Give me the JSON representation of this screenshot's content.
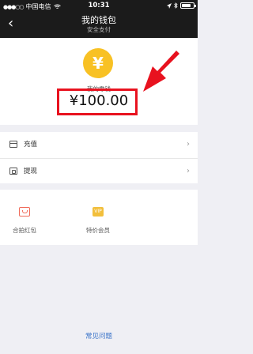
{
  "status_bar": {
    "carrier": "中国电信",
    "time": "10:31",
    "battery_level": 0.75
  },
  "nav": {
    "back_icon": "‹",
    "title": "我的钱包",
    "subtitle": "安全支付"
  },
  "balance": {
    "coin_symbol": "¥",
    "label": "我的零钱",
    "amount": "¥100.00"
  },
  "menu": {
    "items": [
      {
        "label": "充值",
        "icon": "card-icon"
      },
      {
        "label": "提现",
        "icon": "wallet-icon"
      }
    ]
  },
  "services": {
    "items": [
      {
        "label": "合拍红包",
        "icon": "red-envelope-icon"
      },
      {
        "label": "特价会员",
        "icon": "vip-icon",
        "icon_text": "VIP"
      }
    ]
  },
  "footer": {
    "link": "常见问题"
  },
  "colors": {
    "highlight": "#e8121f",
    "coin": "#f8c124",
    "link": "#3a73c9"
  }
}
